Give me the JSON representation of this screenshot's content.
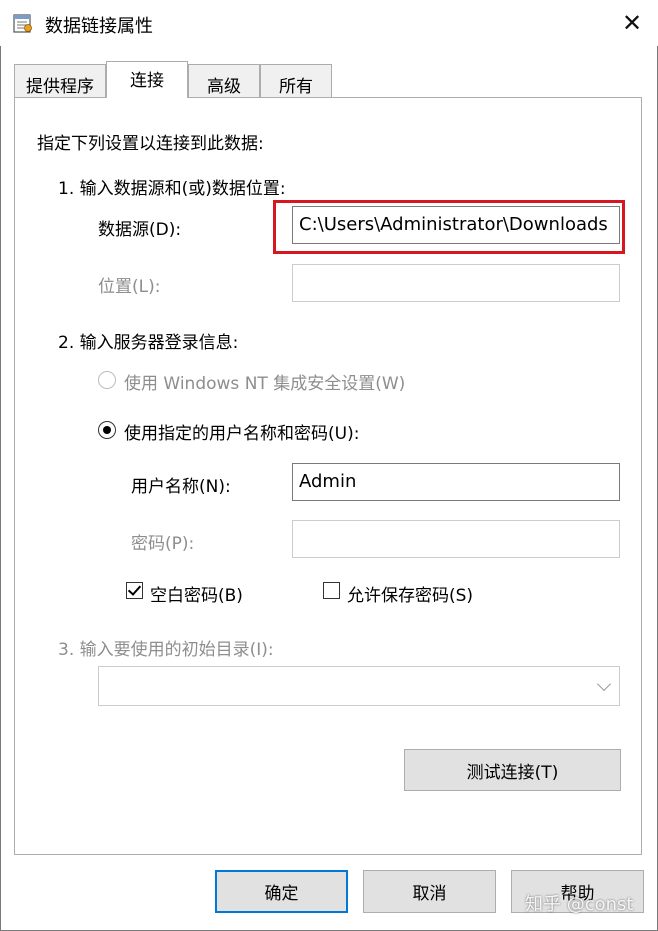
{
  "window": {
    "title": "数据链接属性",
    "close_glyph": "✕"
  },
  "tabs": [
    {
      "label": "提供程序",
      "active": false
    },
    {
      "label": "连接",
      "active": true
    },
    {
      "label": "高级",
      "active": false
    },
    {
      "label": "所有",
      "active": false
    }
  ],
  "connection": {
    "intro": "指定下列设置以连接到此数据:",
    "step1": {
      "heading": "1. 输入数据源和(或)数据位置:",
      "datasource_label": "数据源(D):",
      "datasource_value": "C:\\Users\\Administrator\\Downloads",
      "location_label": "位置(L):",
      "location_value": ""
    },
    "step2": {
      "heading": "2. 输入服务器登录信息:",
      "radio_nt": "使用 Windows NT 集成安全设置(W)",
      "radio_custom": "使用指定的用户名称和密码(U):",
      "selected": "custom",
      "username_label": "用户名称(N):",
      "username_value": "Admin",
      "password_label": "密码(P):",
      "password_value": "",
      "blank_password_label": "空白密码(B)",
      "blank_password_checked": true,
      "allow_save_label": "允许保存密码(S)",
      "allow_save_checked": false
    },
    "step3": {
      "heading": "3. 输入要使用的初始目录(I):",
      "catalog_value": ""
    },
    "test_button": "测试连接(T)"
  },
  "footer": {
    "ok": "确定",
    "cancel": "取消",
    "help": "帮助"
  },
  "watermark": "知乎 @const",
  "colors": {
    "highlight": "#d7171f",
    "focus": "#0078d7"
  }
}
